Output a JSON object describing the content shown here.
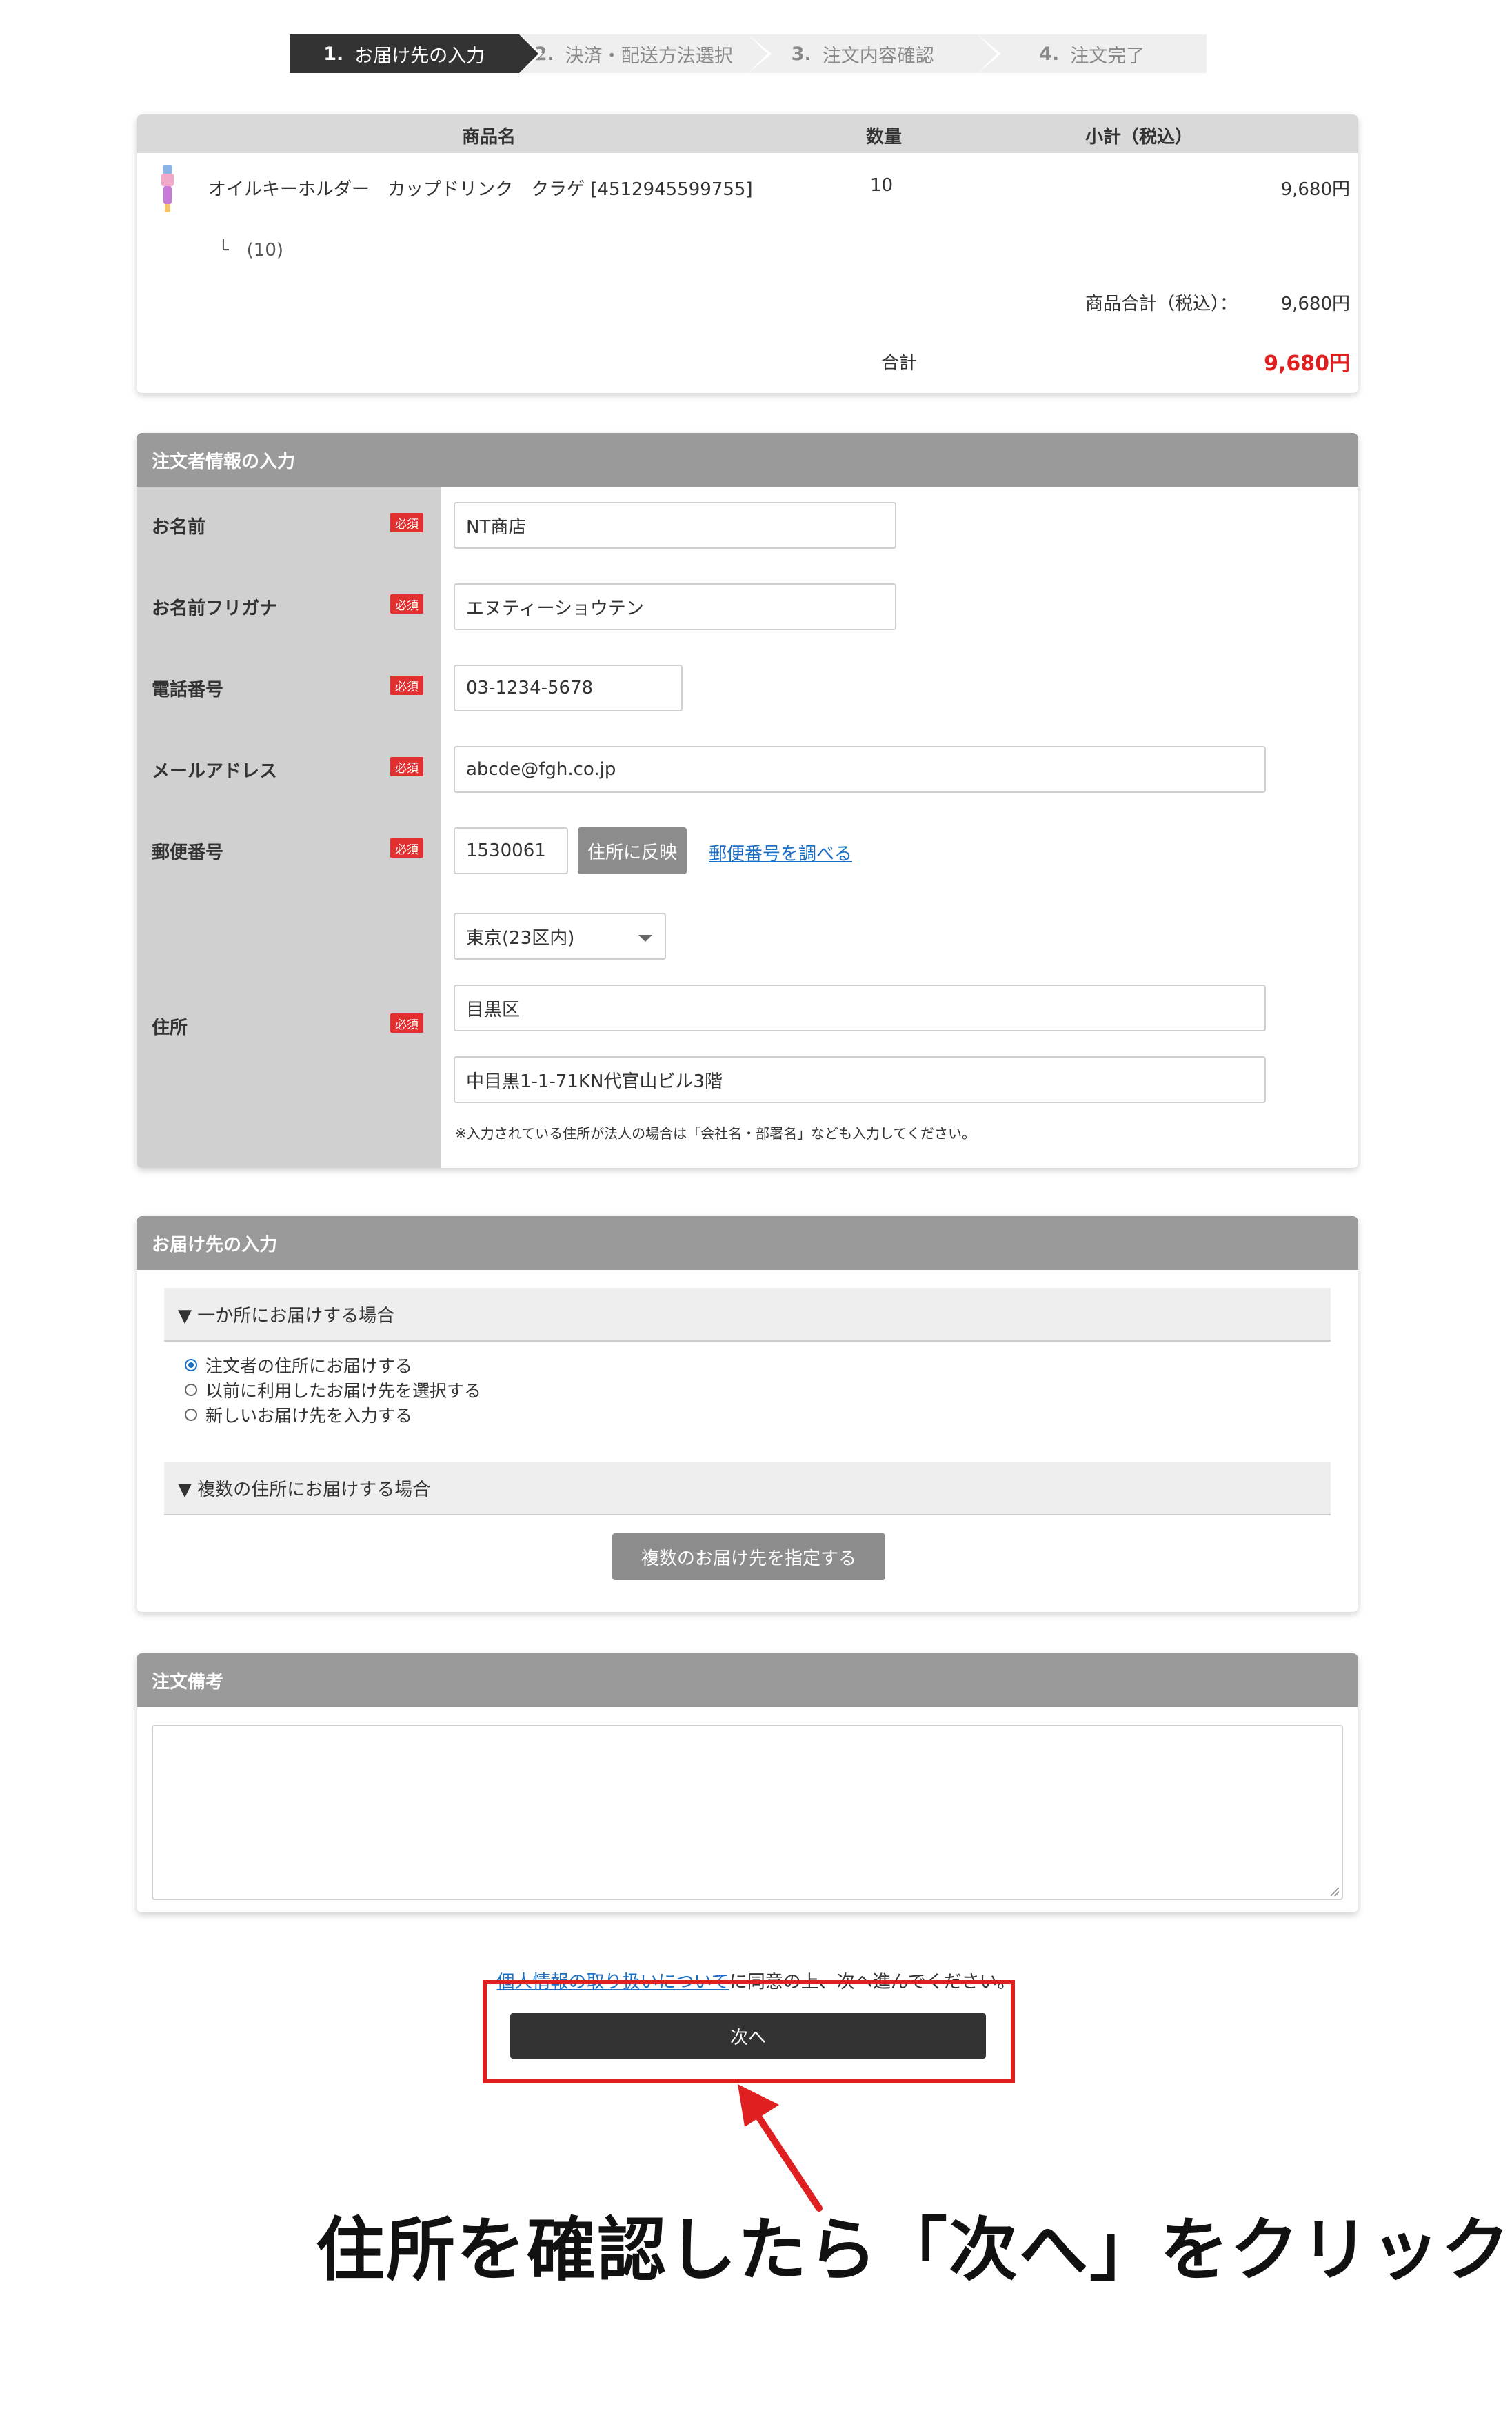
{
  "steps": [
    {
      "num": "1.",
      "label": "お届け先の入力",
      "active": true
    },
    {
      "num": "2.",
      "label": "決済・配送方法選択",
      "active": false
    },
    {
      "num": "3.",
      "label": "注文内容確認",
      "active": false
    },
    {
      "num": "4.",
      "label": "注文完了",
      "active": false
    }
  ],
  "cart": {
    "col_product": "商品名",
    "col_qty": "数量",
    "col_subtotal": "小計（税込）",
    "item_name": "オイルキーホルダー　カップドリンク　クラゲ [4512945599755]",
    "item_qty": "10",
    "item_price": "9,680円",
    "item_option": "└　(10)",
    "goods_total_label": "商品合計（税込）：",
    "goods_total": "9,680円",
    "total_label": "合計",
    "total": "9,680円"
  },
  "customer": {
    "title": "注文者情報の入力",
    "required": "必須",
    "name_label": "お名前",
    "name_value": "NT商店",
    "kana_label": "お名前フリガナ",
    "kana_value": "エヌティーショウテン",
    "tel_label": "電話番号",
    "tel_value": "03-1234-5678",
    "email_label": "メールアドレス",
    "email_value": "abcde@fgh.co.jp",
    "zip_label": "郵便番号",
    "zip_value": "1530061",
    "zip_button": "住所に反映",
    "zip_link": "郵便番号を調べる",
    "address_label": "住所",
    "pref_value": "東京(23区内)",
    "city_value": "目黒区",
    "street_value": "中目黒1-1-71KN代官山ビル3階",
    "address_note": "※入力されている住所が法人の場合は「会社名・部署名」なども入力してください。"
  },
  "delivery": {
    "title": "お届け先の入力",
    "single_head": "▼ 一か所にお届けする場合",
    "options": [
      "注文者の住所にお届けする",
      "以前に利用したお届け先を選択する",
      "新しいお届け先を入力する"
    ],
    "multi_head": "▼ 複数の住所にお届けする場合",
    "multi_button": "複数のお届け先を指定する"
  },
  "remarks": {
    "title": "注文備考"
  },
  "footer": {
    "agree_link": "個人情報の取り扱いについて",
    "agree_rest": "に同意の上、次へ進んでください。",
    "next_button": "次へ"
  },
  "annotation": {
    "caption": "住所を確認したら「次へ」をクリック",
    "color": "#e02020"
  }
}
